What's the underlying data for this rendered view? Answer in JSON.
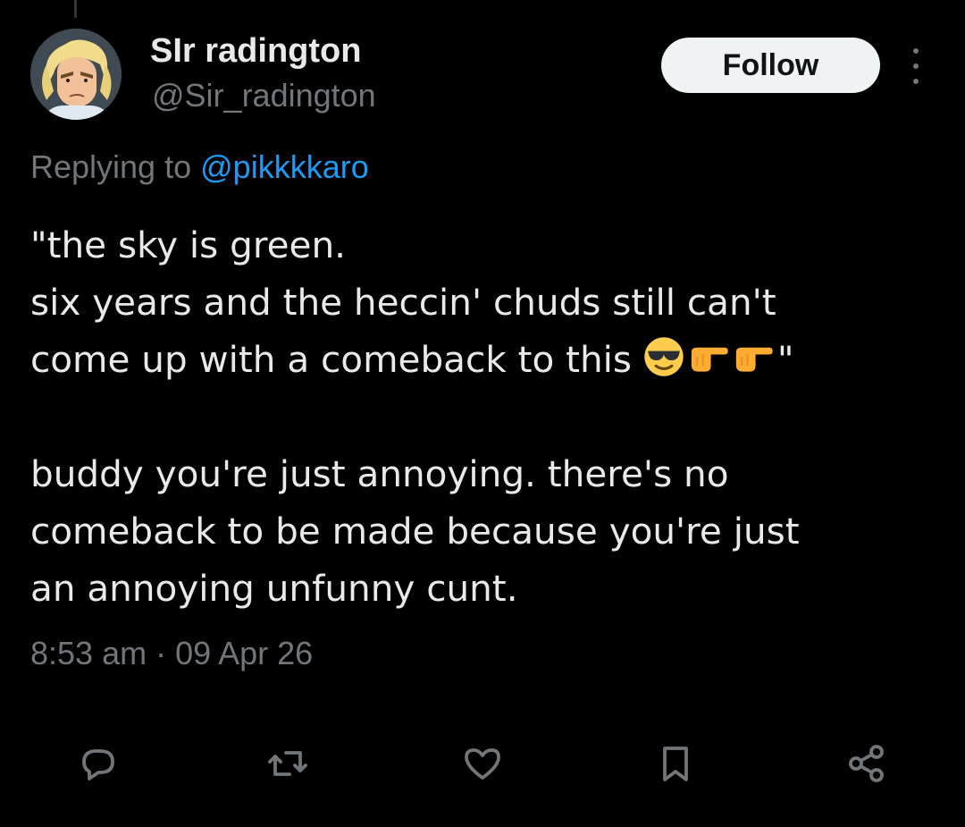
{
  "tweet": {
    "display_name": "SIr radington",
    "handle": "@Sir_radington",
    "follow_label": "Follow",
    "replying_to_prefix": "Replying to",
    "replying_to_handle": "@pikkkkaro",
    "text_lines": [
      "\"the sky is green.",
      "six years and the heccin' chuds still can't",
      "come up with a comeback to this",
      "\"",
      "buddy you're just annoying. there's no",
      "comeback to be made because you're just",
      "an annoying unfunny cunt."
    ],
    "emojis": [
      "smiling-face-with-sunglasses",
      "backhand-index-pointing-right",
      "backhand-index-pointing-right"
    ],
    "timestamp": "8:53 am · 09 Apr 26"
  },
  "colors": {
    "background": "#000000",
    "text_primary": "#e7e9ea",
    "text_secondary": "#71767b",
    "link": "#1d9bf0",
    "follow_button_bg": "#eff3f4"
  },
  "icons": {
    "reply": "reply-icon",
    "repost": "repost-icon",
    "like": "heart-icon",
    "bookmark": "bookmark-icon",
    "share": "share-icon",
    "more": "more-vertical-icon"
  }
}
